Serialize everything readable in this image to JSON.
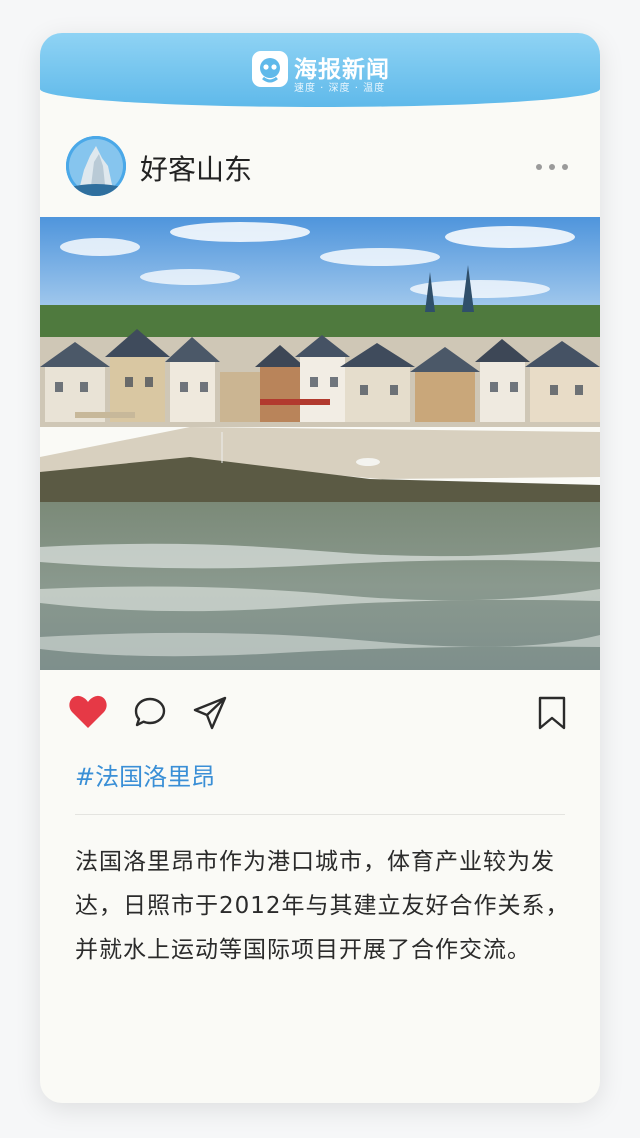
{
  "brand": {
    "name": "海报新闻",
    "slogan": "速度 · 深度 · 温度",
    "colors": {
      "bar_top": "#8fd3f4",
      "bar_bottom": "#5fb9ea"
    }
  },
  "post": {
    "author": "好客山东",
    "avatar_icon": "avatar-image",
    "more_icon": "more-dots-icon",
    "photo_description": "harbor-town-photo",
    "actions": {
      "like_icon": "heart-icon",
      "liked": true,
      "like_color": "#e63946",
      "comment_icon": "comment-icon",
      "share_icon": "send-icon",
      "save_icon": "bookmark-icon"
    },
    "hashtag": "#法国洛里昂",
    "hashtag_color": "#3a8fd6",
    "caption": "法国洛里昂市作为港口城市，体育产业较为发达，日照市于2012年与其建立友好合作关系，并就水上运动等国际项目开展了合作交流。"
  }
}
